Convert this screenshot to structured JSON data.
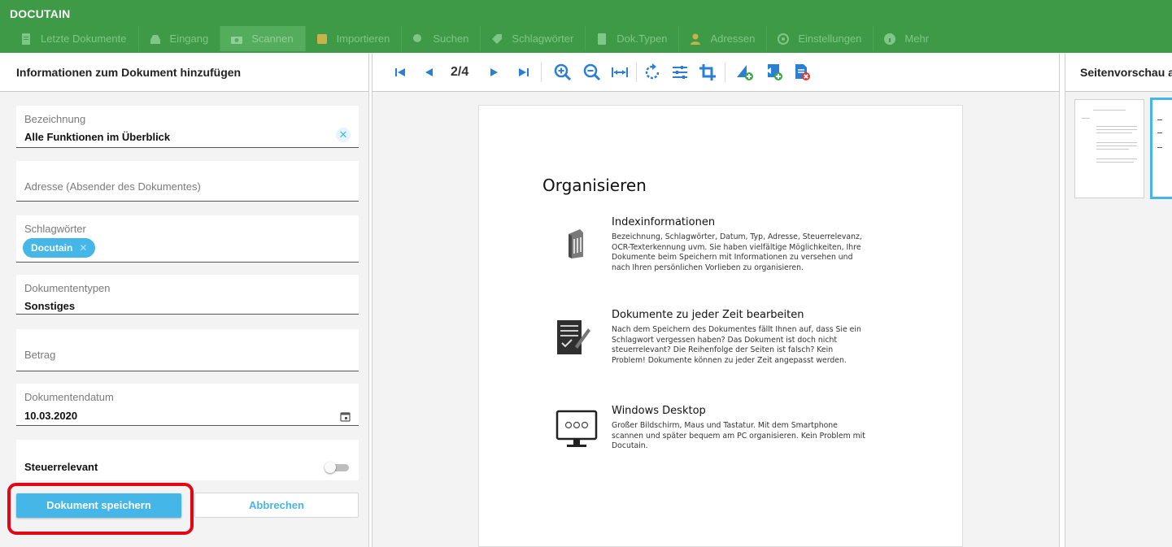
{
  "app": {
    "title": "DOCUTAIN"
  },
  "nav": {
    "items": [
      {
        "label": "Letzte Dokumente",
        "icon": "document-icon"
      },
      {
        "label": "Eingang",
        "icon": "inbox-icon"
      },
      {
        "label": "Scannen",
        "icon": "scan-icon",
        "active": true
      },
      {
        "label": "Importieren",
        "icon": "import-icon"
      },
      {
        "label": "Suchen",
        "icon": "search-icon"
      },
      {
        "label": "Schlagwörter",
        "icon": "tag-icon"
      },
      {
        "label": "Dok.Typen",
        "icon": "doctype-icon"
      },
      {
        "label": "Adressen",
        "icon": "contact-icon"
      },
      {
        "label": "Einstellungen",
        "icon": "gear-icon"
      },
      {
        "label": "Mehr",
        "icon": "info-icon"
      }
    ]
  },
  "left": {
    "title": "Informationen zum Dokument hinzufügen",
    "fields": {
      "bezeichnung": {
        "label": "Bezeichnung",
        "value": "Alle Funktionen im Überblick"
      },
      "adresse": {
        "label": "Adresse (Absender des Dokumentes)"
      },
      "schlagwoerter": {
        "label": "Schlagwörter",
        "chips": [
          "Docutain"
        ]
      },
      "dokumententypen": {
        "label": "Dokumententypen",
        "value": "Sonstiges"
      },
      "betrag": {
        "label": "Betrag"
      },
      "dokumentendatum": {
        "label": "Dokumentendatum",
        "value": "10.03.2020"
      },
      "steuerrelevant": {
        "label": "Steuerrelevant",
        "checked": false
      }
    },
    "buttons": {
      "save": "Dokument speichern",
      "cancel": "Abbrechen"
    },
    "highlight_color": "#e30613"
  },
  "toolbar": {
    "pager": "2/4",
    "icons": [
      "first-page-icon",
      "prev-page-icon",
      "next-page-icon",
      "last-page-icon",
      "zoom-in-icon",
      "zoom-out-icon",
      "fit-width-icon",
      "rotate-icon",
      "adjust-icon",
      "crop-icon",
      "add-page-icon",
      "insert-page-icon",
      "delete-page-icon"
    ]
  },
  "document": {
    "heading": "Organisieren",
    "sections": [
      {
        "title": "Indexinformationen",
        "lines": [
          "Bezeichnung, Schlagwörter, Datum, Typ, Adresse, Steuerrelevanz,",
          "OCR-Texterkennung uvm. Sie haben vielfältige Möglichkeiten, Ihre",
          "Dokumente beim Speichern mit Informationen zu versehen und",
          "nach Ihren persönlichen Vorlieben zu organisieren."
        ]
      },
      {
        "title": "Dokumente zu jeder Zeit bearbeiten",
        "lines": [
          "Nach dem Speichern des Dokumentes fällt Ihnen auf, dass Sie ein",
          "Schlagwort vergessen haben? Das Dokument ist doch nicht",
          "steuerrelevant? Die Reihenfolge der Seiten ist falsch? Kein",
          "Problem! Dokumente können zu jeder Zeit angepasst werden."
        ]
      },
      {
        "title": "Windows Desktop",
        "lines": [
          "Großer Bildschirm, Maus und Tastatur. Mit dem Smartphone",
          "scannen und später bequem am PC organisieren. Kein Problem mit",
          "Docutain."
        ]
      }
    ]
  },
  "right": {
    "title": "Seitenvorschau a"
  },
  "colors": {
    "header_green": "#3e9a46",
    "accent_blue": "#45b6e8",
    "highlight_red": "#e30613"
  }
}
